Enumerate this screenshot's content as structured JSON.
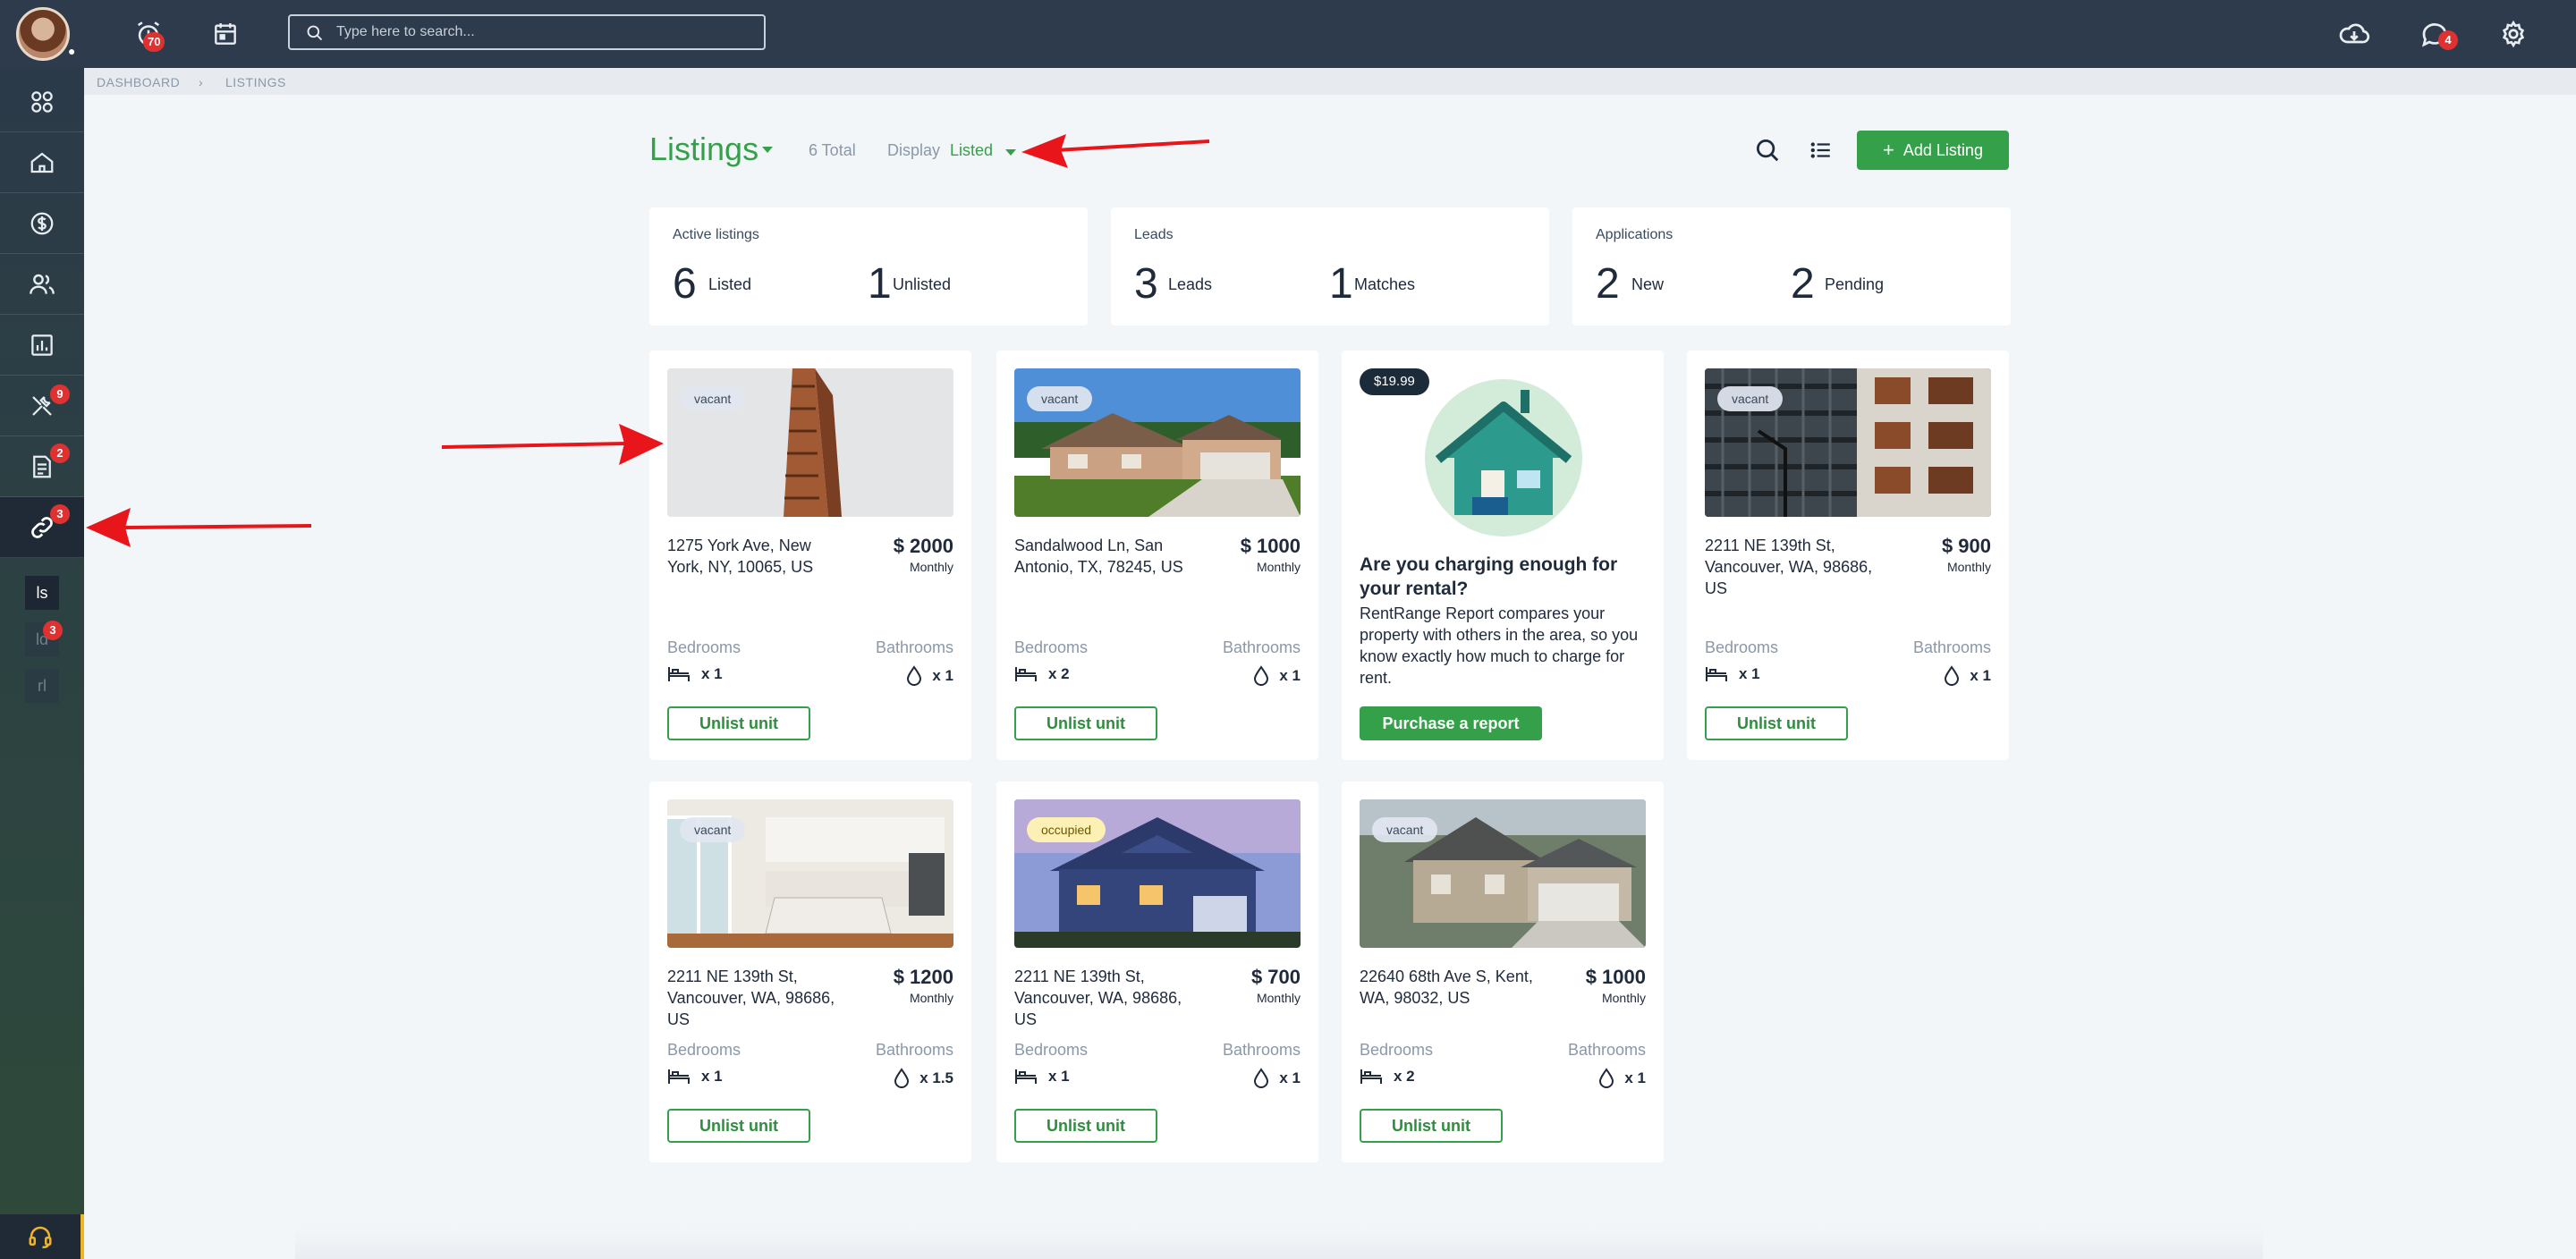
{
  "topbar": {
    "alerts_badge": "70",
    "messages_badge": "4",
    "search_placeholder": "Type here to search..."
  },
  "sidebar": {
    "badges": {
      "tools": "9",
      "documents": "2",
      "listings": "3",
      "leads_sub": "3"
    },
    "sub_items": [
      "ls",
      "ld",
      "rl"
    ]
  },
  "breadcrumb": {
    "root": "DASHBOARD",
    "current": "LISTINGS"
  },
  "header": {
    "title": "Listings",
    "total": "6 Total",
    "display_label": "Display",
    "display_value": "Listed",
    "add_label": "Add Listing"
  },
  "stats": [
    {
      "label": "Active listings",
      "a_num": "6",
      "a_text": "Listed",
      "b_num": "1",
      "b_text": "Unlisted"
    },
    {
      "label": "Leads",
      "a_num": "3",
      "a_text": "Leads",
      "b_num": "1",
      "b_text": "Matches"
    },
    {
      "label": "Applications",
      "a_num": "2",
      "a_text": "New",
      "b_num": "2",
      "b_text": "Pending"
    }
  ],
  "common": {
    "bedrooms": "Bedrooms",
    "bathrooms": "Bathrooms",
    "monthly": "Monthly",
    "unlist": "Unlist unit"
  },
  "listings": [
    {
      "status": "vacant",
      "address": "1275 York Ave, New York, NY, 10065, US",
      "price": "$ 2000",
      "beds": "x 1",
      "baths": "x 1"
    },
    {
      "status": "vacant",
      "address": "Sandalwood Ln, San Antonio, TX, 78245, US",
      "price": "$ 1000",
      "beds": "x 2",
      "baths": "x 1"
    },
    {
      "status": "vacant",
      "address": "2211 NE 139th St, Vancouver, WA, 98686, US",
      "price": "$ 900",
      "beds": "x 1",
      "baths": "x 1"
    },
    {
      "status": "vacant",
      "address": "2211 NE 139th St, Vancouver, WA, 98686, US",
      "price": "$ 1200",
      "beds": "x 1",
      "baths": "x 1.5"
    },
    {
      "status": "occupied",
      "address": "2211 NE 139th St, Vancouver, WA, 98686, US",
      "price": "$ 700",
      "beds": "x 1",
      "baths": "x 1"
    },
    {
      "status": "vacant",
      "address": "22640 68th Ave S, Kent, WA, 98032, US",
      "price": "$ 1000",
      "beds": "x 2",
      "baths": "x 1"
    }
  ],
  "promo": {
    "price": "$19.99",
    "title": "Are you charging enough for your rental?",
    "body": "RentRange Report compares your property with others in the area, so you know exactly how much to charge for rent.",
    "button": "Purchase a report"
  },
  "colors": {
    "accent": "#35a04a",
    "topbar": "#2d3b4c",
    "badge": "#e03131",
    "arrow": "#e8151b"
  }
}
